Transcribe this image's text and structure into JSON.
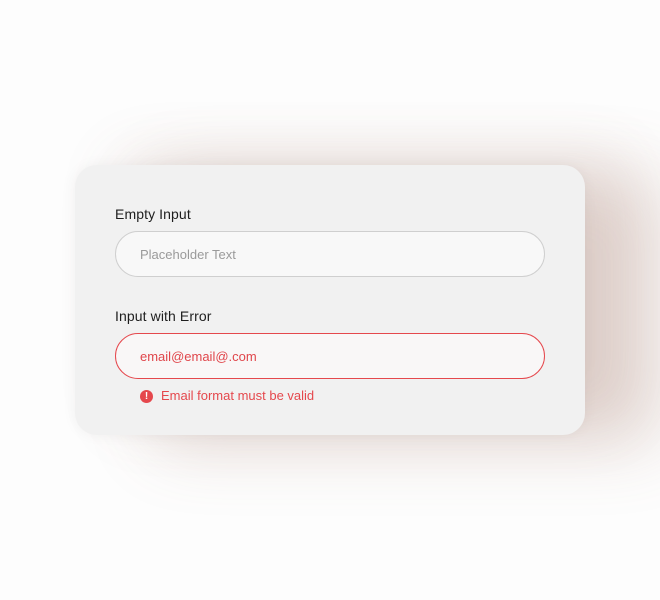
{
  "form": {
    "empty_field": {
      "label": "Empty Input",
      "value": "",
      "placeholder": "Placeholder Text"
    },
    "error_field": {
      "label": "Input with Error",
      "value": "email@email@.com",
      "placeholder": "",
      "error_message": "Email format must be valid",
      "error_icon": "!"
    }
  },
  "colors": {
    "error": "#e5484d",
    "card_background": "#f1f1f1",
    "input_border": "#cfcfcf"
  }
}
